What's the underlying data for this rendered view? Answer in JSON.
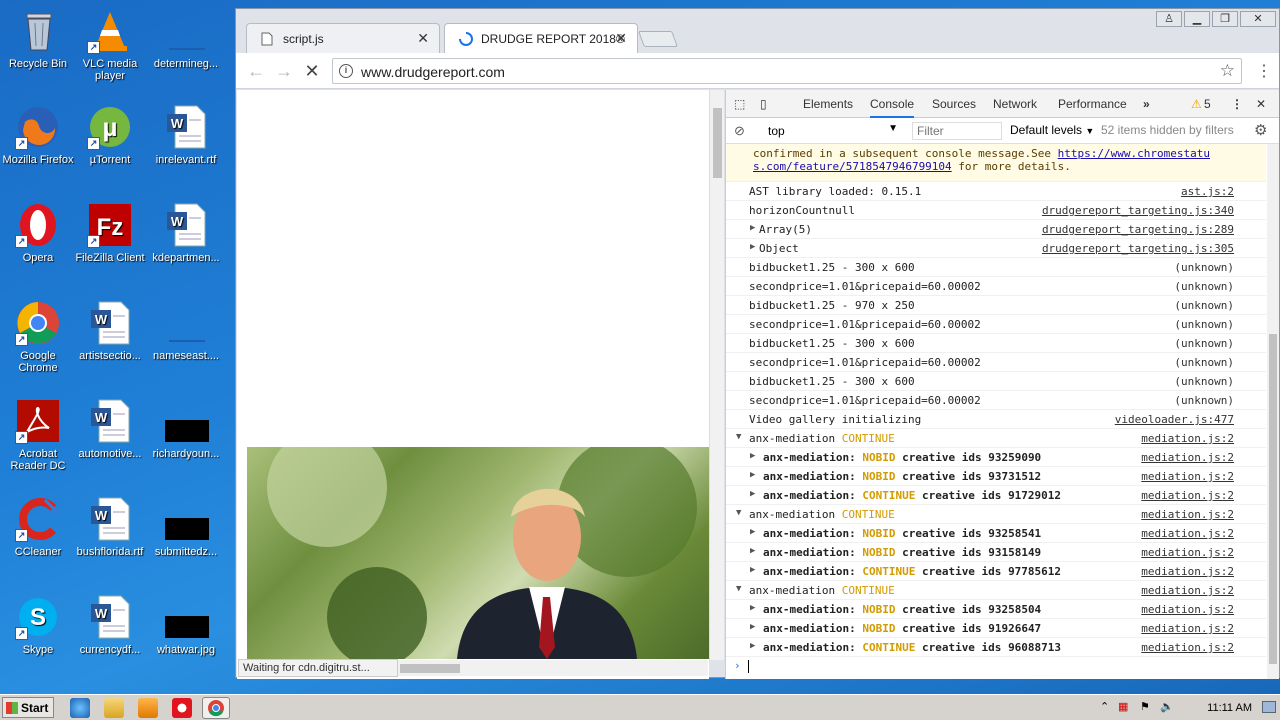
{
  "desktop": {
    "icons": [
      {
        "label": "Recycle Bin"
      },
      {
        "label": "VLC media player"
      },
      {
        "label": "determineg..."
      },
      {
        "label": "Mozilla Firefox"
      },
      {
        "label": "µTorrent"
      },
      {
        "label": "inrelevant.rtf"
      },
      {
        "label": "Opera"
      },
      {
        "label": "FileZilla Client"
      },
      {
        "label": "kdepartmen..."
      },
      {
        "label": "Google Chrome"
      },
      {
        "label": "artistsectio..."
      },
      {
        "label": "nameseast...."
      },
      {
        "label": "Acrobat Reader DC"
      },
      {
        "label": "automotive..."
      },
      {
        "label": "richardyoun..."
      },
      {
        "label": "CCleaner"
      },
      {
        "label": "bushflorida.rtf"
      },
      {
        "label": "submittedz..."
      },
      {
        "label": "Skype"
      },
      {
        "label": "currencydf..."
      },
      {
        "label": "whatwar.jpg"
      }
    ]
  },
  "browser": {
    "tabs": [
      {
        "title": "script.js",
        "close": "✕"
      },
      {
        "title": "DRUDGE REPORT 2018®",
        "close": "✕"
      }
    ],
    "url": "www.drudgereport.com",
    "status": "Waiting for cdn.digitru.st..."
  },
  "devtools": {
    "tabs": [
      "Elements",
      "Console",
      "Sources",
      "Network",
      "Performance"
    ],
    "more": "»",
    "warnings": "5",
    "context": "top",
    "filter_placeholder": "Filter",
    "levels": "Default levels",
    "hidden": "52 items hidden by filters",
    "log": {
      "first_line_a": "confirmed in a subsequent console message.See ",
      "first_link_a": "https://www.chromestatu",
      "first_link_b": "s.com/feature/5718547946799104",
      "first_line_b": " for more details.",
      "rows": [
        {
          "text": "AST library loaded: 0.15.1",
          "src": "ast.js:2"
        },
        {
          "text": "horizonCountnull",
          "src": "drudgereport_targeting.js:340"
        },
        {
          "text": "Array(5)",
          "src": "drudgereport_targeting.js:289"
        },
        {
          "text": "Object",
          "src": "drudgereport_targeting.js:305"
        },
        {
          "text": "bidbucket1.25 - 300 x 600",
          "src": "(unknown)"
        },
        {
          "text": "secondprice=1.01&pricepaid=60.00002",
          "src": "(unknown)"
        },
        {
          "text": "bidbucket1.25 - 970 x 250",
          "src": "(unknown)"
        },
        {
          "text": "secondprice=1.01&pricepaid=60.00002",
          "src": "(unknown)"
        },
        {
          "text": "bidbucket1.25 - 300 x 600",
          "src": "(unknown)"
        },
        {
          "text": "secondprice=1.01&pricepaid=60.00002",
          "src": "(unknown)"
        },
        {
          "text": "bidbucket1.25 - 300 x 600",
          "src": "(unknown)"
        },
        {
          "text": "secondprice=1.01&pricepaid=60.00002",
          "src": "(unknown)"
        },
        {
          "text": "Video gallery initializing",
          "src": "videoloader.js:477"
        }
      ],
      "mediation_prefix": "anx-mediation",
      "mediation_nested_prefix": "anx-mediation:",
      "continue": "CONTINUE",
      "nobid": "NOBID",
      "creative": "creative ids",
      "src": "mediation.js:2",
      "ids": [
        "93259090",
        "93731512",
        "91729012",
        "93258541",
        "93158149",
        "97785612",
        "93258504",
        "91926647",
        "96088713"
      ]
    }
  },
  "taskbar": {
    "start": "Start",
    "clock": "11:11 AM"
  }
}
